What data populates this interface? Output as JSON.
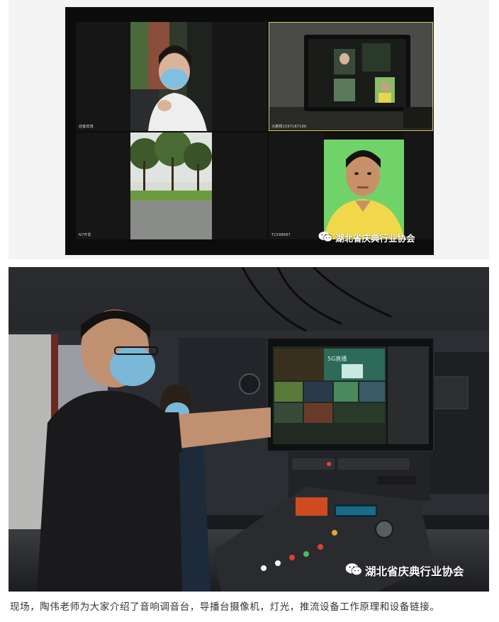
{
  "top_image": {
    "tiles": [
      {
        "label": "迎客宾馆",
        "active": false
      },
      {
        "label": "大鹏翔1597187166",
        "active": true
      },
      {
        "label": "N7开发",
        "active": false
      },
      {
        "label": "T1598687",
        "active": false
      }
    ],
    "watermark": "湖北省庆典行业协会"
  },
  "bottom_image": {
    "monitor_text": "5G直播",
    "watermark": "湖北省庆典行业协会"
  },
  "caption": "现场，陶伟老师为大家介绍了音响调音台，导播台摄像机，灯光，推流设备工作原理和设备链接。",
  "colors": {
    "page_bg": "#ffffff",
    "band_bg": "#f4f4f4",
    "caption_text": "#333333",
    "active_tile_border": "#d8c84a"
  },
  "icons": {
    "watermark": "wechat-icon"
  }
}
